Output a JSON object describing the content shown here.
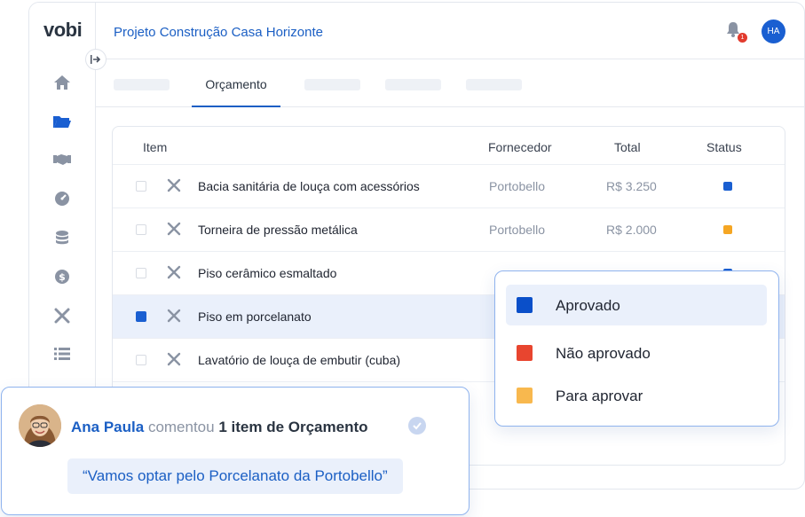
{
  "app": {
    "logo": "vobi",
    "project_title": "Projeto Construção Casa Horizonte",
    "notifications_count": "1",
    "user_initials": "HA"
  },
  "sidebar": {
    "icons": [
      "home-icon",
      "folder-icon",
      "handshake-icon",
      "gauge-icon",
      "coins-icon",
      "dollar-icon",
      "tools-icon",
      "list-icon"
    ]
  },
  "tabs": {
    "active_label": "Orçamento"
  },
  "table": {
    "headers": {
      "item": "Item",
      "supplier": "Fornecedor",
      "total": "Total",
      "status": "Status"
    },
    "rows": [
      {
        "name": "Bacia sanitária de louça com acessórios",
        "supplier": "Portobello",
        "total": "R$ 3.250",
        "status_color": "#1a5fd1",
        "checked": false
      },
      {
        "name": "Torneira de pressão metálica",
        "supplier": "Portobello",
        "total": "R$ 2.000",
        "status_color": "#f5a623",
        "checked": false
      },
      {
        "name": "Piso cerâmico esmaltado",
        "supplier": "",
        "total": "",
        "status_color": "#1a5fd1",
        "checked": false
      },
      {
        "name": "Piso em porcelanato",
        "supplier": "",
        "total": "",
        "status_color": "",
        "checked": true
      },
      {
        "name": "Lavatório de louça de embutir (cuba)",
        "supplier": "",
        "total": "",
        "status_color": "",
        "checked": false
      }
    ]
  },
  "status_dropdown": {
    "options": [
      {
        "label": "Aprovado",
        "color": "#0a4fc9"
      },
      {
        "label": "Não aprovado",
        "color": "#e8452f"
      },
      {
        "label": "Para aprovar",
        "color": "#f8b84e"
      }
    ]
  },
  "comment": {
    "author": "Ana Paula",
    "verb": "comentou",
    "subject": "1 item de Orçamento",
    "quote": "“Vamos optar pelo Porcelanato da Portobello”"
  },
  "colors": {
    "brand_blue": "#1b5fc4",
    "selected_row": "#eaf0fb"
  }
}
